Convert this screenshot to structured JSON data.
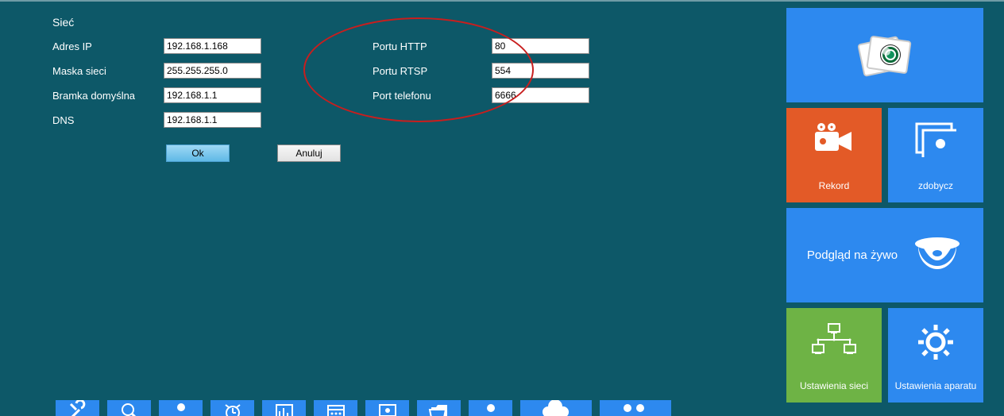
{
  "section_title": "Sieć",
  "left_fields": [
    {
      "label": "Adres IP",
      "value": "192.168.1.168"
    },
    {
      "label": "Maska sieci",
      "value": "255.255.255.0"
    },
    {
      "label": "Bramka domyślna",
      "value": "192.168.1.1"
    },
    {
      "label": "DNS",
      "value": "192.168.1.1"
    }
  ],
  "right_fields": [
    {
      "label": "Portu HTTP",
      "value": "80"
    },
    {
      "label": "Portu RTSP",
      "value": "554"
    },
    {
      "label": "Port telefonu",
      "value": "6666"
    }
  ],
  "buttons": {
    "ok": "Ok",
    "cancel": "Anuluj"
  },
  "tiles": {
    "photos": "",
    "record": "Rekord",
    "capture": "zdobycz",
    "live": "Podgląd na żywo",
    "network": "Ustawienia sieci",
    "camera": "Ustawienia aparatu"
  }
}
